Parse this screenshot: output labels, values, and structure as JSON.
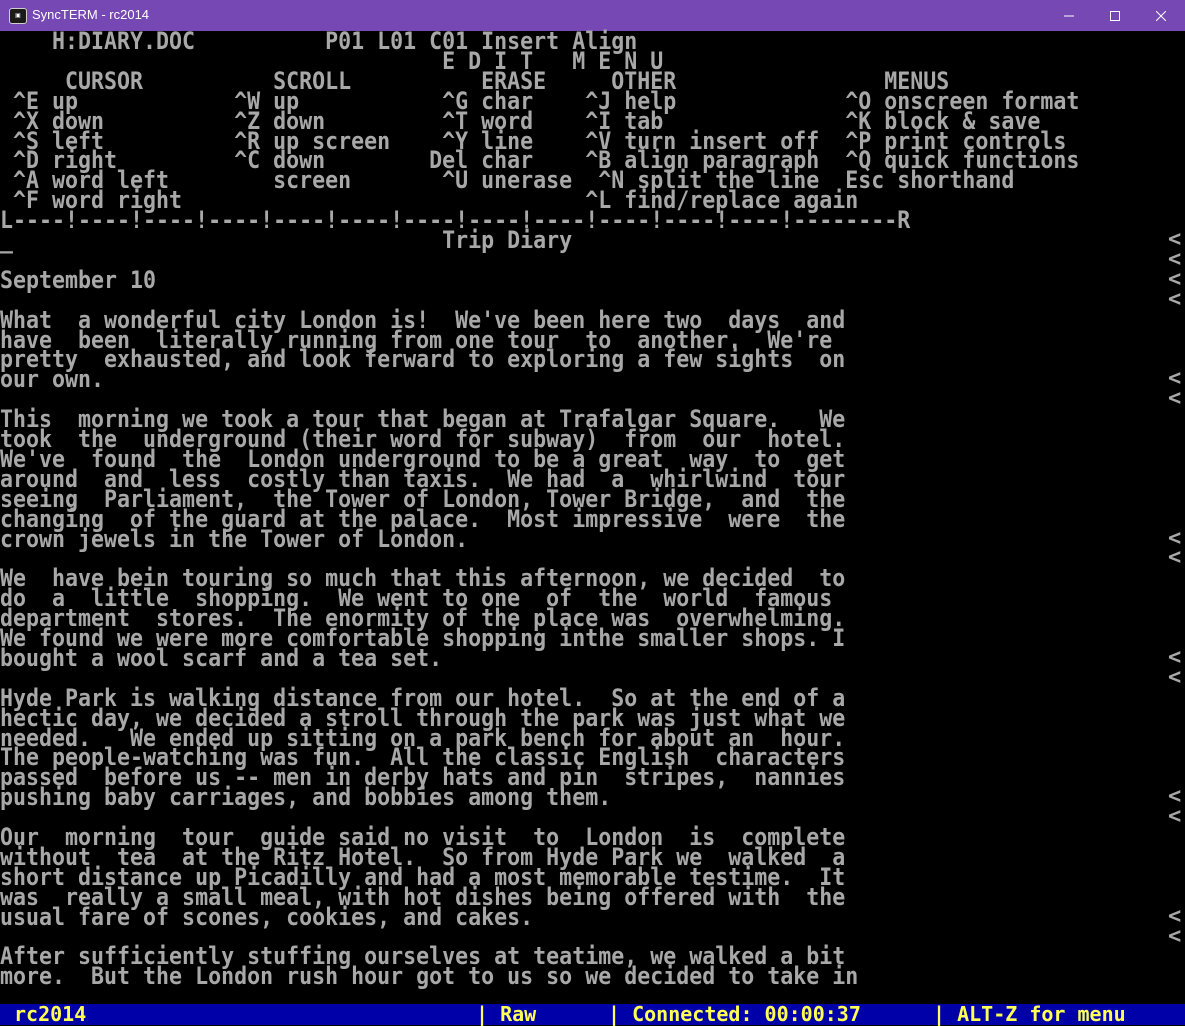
{
  "window": {
    "title": "SyncTERM - rc2014",
    "icon": "syncterm-app-icon",
    "titlebar_color": "#7548b4"
  },
  "terminal": {
    "header_lines": [
      "    H:DIARY.DOC          P01 L01 C01 Insert Align",
      "                                  E D I T   M E N U",
      "     CURSOR          SCROLL          ERASE     OTHER                MENUS",
      " ^E up            ^W up           ^G char    ^J help             ^O onscreen format",
      " ^X down          ^Z down         ^T word    ^I tab              ^K block & save",
      " ^S left          ^R up screen    ^Y line    ^V turn insert off  ^P print controls",
      " ^D right         ^C down        Del char    ^B align paragraph  ^Q quick functions",
      " ^A word left        screen       ^U unerase  ^N split the line  Esc shorthand",
      " ^F word right                               ^L find/replace again",
      "L----!----!----!----!----!----!----!----!----!----!----!----!--------R"
    ],
    "document_lines": [
      "_                                 Trip Diary",
      "",
      "September 10",
      "",
      "What  a wonderful city London is!  We've been here two  days  and",
      "have  been  literally running from one tour  to  another.  We're",
      "pretty  exhausted, and look ferward to exploring a few sights  on",
      "our own.",
      "",
      "This  morning we took a tour that began at Trafalgar Square.   We",
      "took  the  underground (their word for subway)  from  our  hotel.",
      "We've  found  the  London underground to be a great  way  to  get",
      "around  and  less  costly than taxis.  We had  a  whirlwind  tour",
      "seeing  Parliament,  the Tower of London, Tower Bridge,  and  the",
      "changing  of the guard at the palace.  Most impressive  were  the",
      "crown jewels in the Tower of London.",
      "",
      "We  have bein touring so much that this afternoon, we decided  to",
      "do  a  little  shopping.  We went to one  of  the  world  famous",
      "department  stores.  The enormity of the place was  overwhelming.",
      "We found we were more comfortable shopping inthe smaller shops. I",
      "bought a wool scarf and a tea set.",
      "",
      "Hyde Park is walking distance from our hotel.  So at the end of a",
      "hectic day, we decided a stroll through the park was just what we",
      "needed.   We ended up sitting on a park bench for about an  hour.",
      "The people-watching was fun.  All the classic English  characters",
      "passed  before us -- men in derby hats and pin  stripes,  nannies",
      "pushing baby carriages, and bobbies among them.",
      "",
      "Our  morning  tour  guide said no visit  to  London  is  complete",
      "without  tea  at the Ritz Hotel.  So from Hyde Park we  walked  a",
      "short distance up Picadilly and had a most memorable testime.  It",
      "was  really a small meal, with hot dishes being offered with  the",
      "usual fare of scones, cookies, and cakes.",
      "",
      "After sufficiently stuffing ourselves at teatime, we walked a bit",
      "more.  But the London rush hour got to us so we decided to take in"
    ],
    "paragraph_marker": "<",
    "marker_rows": [
      0,
      1,
      2,
      3,
      7,
      8,
      15,
      16,
      21,
      22,
      28,
      29,
      34,
      35
    ]
  },
  "status": {
    "host": "rc2014",
    "mode": "| Raw",
    "connection": "| Connected: 00:00:37",
    "menu_hint": "| ALT-Z for menu",
    "bar_color": "#0000a8",
    "text_color": "#ffff55"
  }
}
